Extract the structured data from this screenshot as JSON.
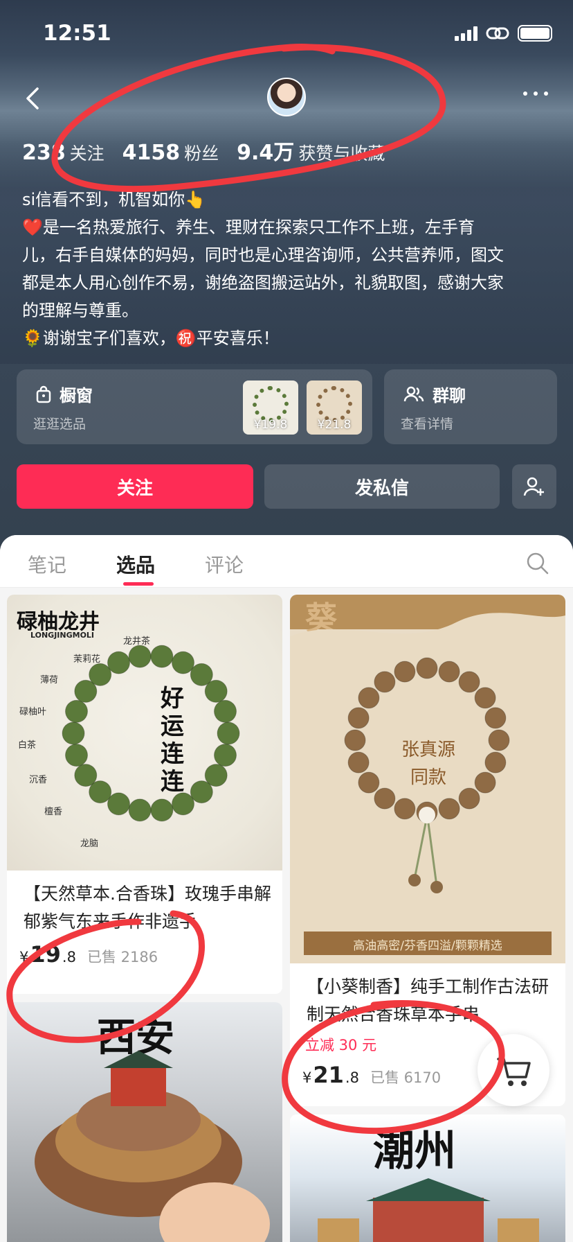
{
  "status_bar": {
    "time": "12:51"
  },
  "profile": {
    "stats": [
      {
        "num": "238",
        "label": "关注"
      },
      {
        "num": "4158",
        "label": "粉丝"
      },
      {
        "num": "9.4万",
        "label": "获赞与收藏"
      }
    ],
    "bio_lines": [
      "si信看不到，机智如你👆",
      "❤️是一名热爱旅行、养生、理财在探索只工作不上班，左手育",
      "儿，右手自媒体的妈妈，同时也是心理咨询师，公共营养师，图文",
      "都是本人用心创作不易，谢绝盗图搬运站外，礼貌取图，感谢大家",
      "的理解与尊重。",
      "🌻谢谢宝子们喜欢，㊗️平安喜乐！"
    ]
  },
  "shop_card": {
    "title": "橱窗",
    "subtitle": "逛逛选品",
    "thumb_prices": [
      "¥19.8",
      "¥21.8"
    ]
  },
  "group_card": {
    "title": "群聊",
    "subtitle": "查看详情"
  },
  "actions": {
    "follow": "关注",
    "message": "发私信"
  },
  "tabs": [
    "笔记",
    "选品",
    "评论"
  ],
  "active_tab": "选品",
  "products": [
    {
      "image_heading": "碌柚龙井",
      "image_subheading": "LONGJINGMOLI",
      "image_text": "好运连连",
      "image_ingredients": [
        "龙井茶",
        "茉莉花",
        "薄荷",
        "碌柚叶",
        "白茶",
        "沉香",
        "檀香",
        "龙脑"
      ],
      "title": "【天然草本.合香珠】玫瑰手串解郁紫气东来手作非遗手",
      "price_int": "19",
      "price_dec": ".8",
      "sold": "已售 2186"
    },
    {
      "image_heading": "葵",
      "image_text": "张真源同款",
      "image_banner": "高油高密/芬香四溢/颗颗精选",
      "title": "【小葵制香】纯手工制作古法研制天然合香珠草本手串",
      "discount": "立减 30 元",
      "price_int": "21",
      "price_dec": ".8",
      "sold": "已售 6170"
    },
    {
      "image_heading": "西安"
    },
    {
      "image_heading": "潮州"
    }
  ],
  "currency": "¥",
  "colors": {
    "accent": "#fe2c55",
    "header_bg": "#34414f",
    "annotation": "#f0393f"
  }
}
